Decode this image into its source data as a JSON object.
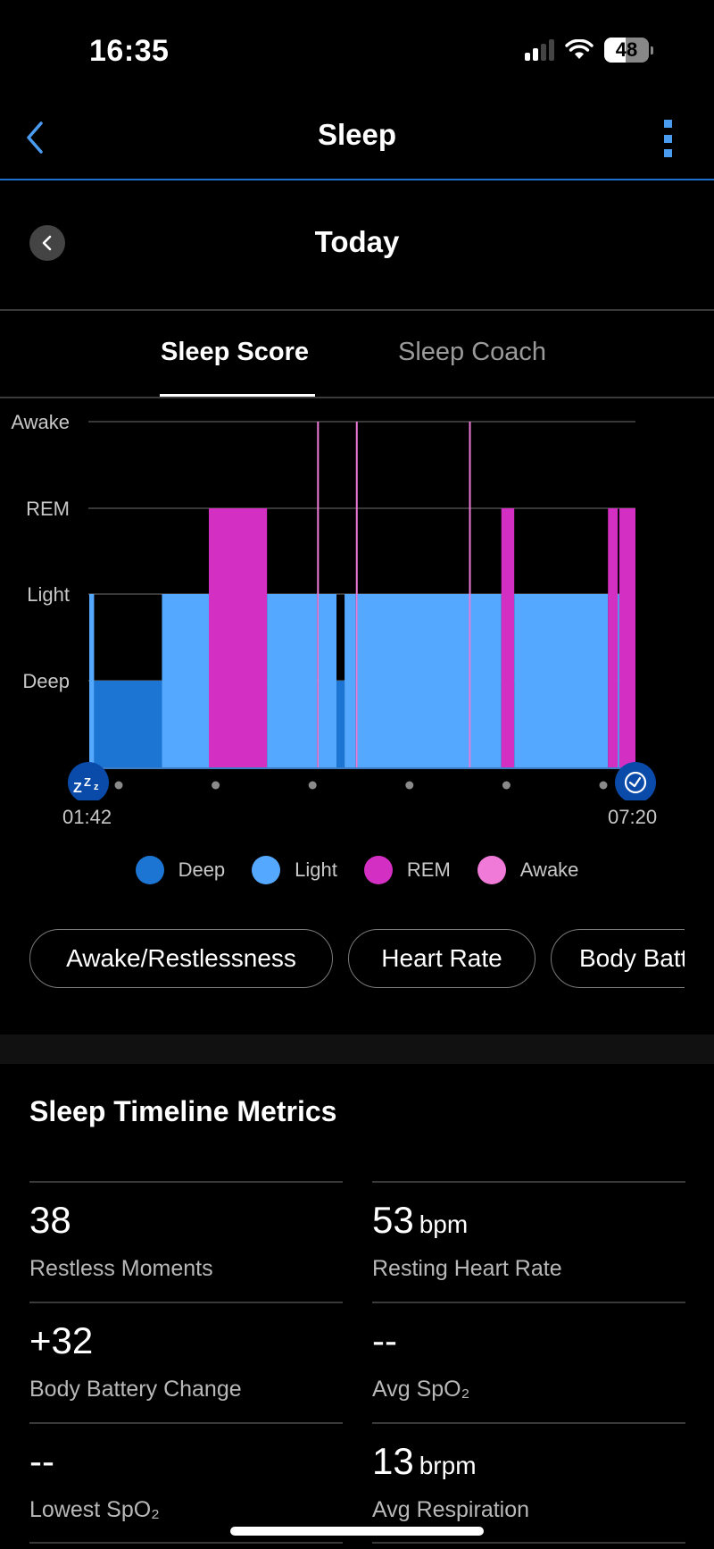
{
  "status_bar": {
    "time": "16:35",
    "battery": "48",
    "battery_level": 0.48,
    "signal_bars_active": 2,
    "signal_bars_total": 4
  },
  "nav": {
    "title": "Sleep",
    "back_icon": "chevron-left-icon",
    "more_icon": "more-vertical-icon",
    "accent": "#4a9cf0"
  },
  "date_row": {
    "title": "Today",
    "prev_icon": "chevron-left-icon"
  },
  "tabs": [
    {
      "label": "Sleep Score",
      "active": true
    },
    {
      "label": "Sleep Coach",
      "active": false
    }
  ],
  "chart_data": {
    "type": "bar",
    "subtype": "hypnogram",
    "title": "",
    "xlabel": "",
    "ylabel": "",
    "levels": [
      "Deep",
      "Light",
      "REM",
      "Awake"
    ],
    "x_start_label": "01:42",
    "x_end_label": "07:20",
    "x_range_minutes": [
      0,
      338
    ],
    "start_icon": "zzz-sleep-icon",
    "end_icon": "clock-icon",
    "tick_dots": 6,
    "colors": {
      "Deep": "#1c75d2",
      "Light": "#55a8ff",
      "REM": "#d42fc3",
      "Awake": "#ef7ad8"
    },
    "segments": [
      {
        "stage": "Light",
        "start": 0,
        "end": 3
      },
      {
        "stage": "Deep",
        "start": 3,
        "end": 45
      },
      {
        "stage": "Light",
        "start": 45,
        "end": 74
      },
      {
        "stage": "REM",
        "start": 74,
        "end": 110
      },
      {
        "stage": "Light",
        "start": 110,
        "end": 141
      },
      {
        "stage": "Awake",
        "start": 141,
        "end": 142
      },
      {
        "stage": "Light",
        "start": 142,
        "end": 153
      },
      {
        "stage": "Deep",
        "start": 153,
        "end": 158
      },
      {
        "stage": "Light",
        "start": 158,
        "end": 165
      },
      {
        "stage": "Awake",
        "start": 165,
        "end": 166
      },
      {
        "stage": "Light",
        "start": 166,
        "end": 235
      },
      {
        "stage": "Awake",
        "start": 235,
        "end": 236
      },
      {
        "stage": "Light",
        "start": 236,
        "end": 255
      },
      {
        "stage": "REM",
        "start": 255,
        "end": 263
      },
      {
        "stage": "Light",
        "start": 263,
        "end": 321
      },
      {
        "stage": "REM",
        "start": 321,
        "end": 327
      },
      {
        "stage": "Light",
        "start": 327,
        "end": 328
      },
      {
        "stage": "REM",
        "start": 328,
        "end": 338
      }
    ],
    "legend": [
      {
        "label": "Deep",
        "color": "#1c75d2"
      },
      {
        "label": "Light",
        "color": "#55a8ff"
      },
      {
        "label": "REM",
        "color": "#d42fc3"
      },
      {
        "label": "Awake",
        "color": "#ef7ad8"
      }
    ],
    "legend_position": "bottom",
    "grid": true
  },
  "chips": [
    {
      "label": "Awake/Restlessness"
    },
    {
      "label": "Heart Rate"
    },
    {
      "label": "Body Battery"
    }
  ],
  "metrics_section": {
    "title": "Sleep Timeline Metrics",
    "items": [
      {
        "value": "38",
        "unit": "",
        "label": "Restless Moments"
      },
      {
        "value": "53",
        "unit": "bpm",
        "label": "Resting Heart Rate"
      },
      {
        "value": "+32",
        "unit": "",
        "label": "Body Battery Change"
      },
      {
        "value": "--",
        "unit": "",
        "label": "Avg SpO₂"
      },
      {
        "value": "--",
        "unit": "",
        "label": "Lowest SpO₂"
      },
      {
        "value": "13",
        "unit": "brpm",
        "label": "Avg Respiration"
      }
    ]
  }
}
